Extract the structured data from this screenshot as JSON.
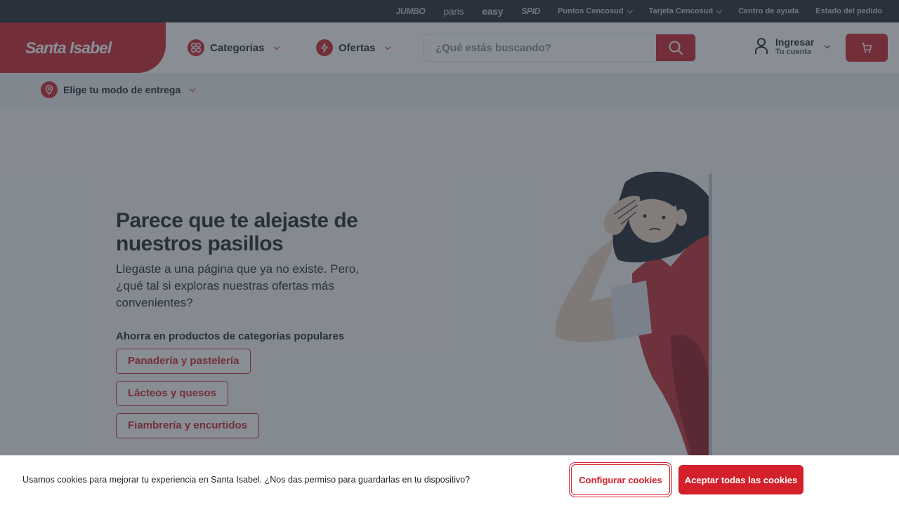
{
  "topbar": {
    "brands": [
      "JUMBO",
      "paris",
      "easy",
      "SPID"
    ],
    "links": [
      {
        "label": "Puntos Cencosud",
        "dropdown": true
      },
      {
        "label": "Tarjeta Cencosud",
        "dropdown": true
      },
      {
        "label": "Centro de ayuda",
        "dropdown": false
      },
      {
        "label": "Estado del pedido",
        "dropdown": false
      }
    ]
  },
  "header": {
    "logo": "Santa Isabel",
    "categories_label": "Categorías",
    "offers_label": "Ofertas",
    "search_placeholder": "¿Qué estás buscando?",
    "account_title": "Ingresar",
    "account_subtitle": "Tu cuenta"
  },
  "delivery": {
    "label": "Elige tu modo de entrega"
  },
  "main": {
    "title": "Parece que te alejaste de nuestros pasillos",
    "description": "Llegaste a una página que ya no existe. Pero, ¿qué tal si exploras nuestras ofertas más convenientes?",
    "categories_title": "Ahorra en productos de categorías populares",
    "categories": [
      "Panadería y pastelería",
      "Lácteos y quesos",
      "Fiambrería y encurtidos"
    ]
  },
  "cookie": {
    "message": "Usamos cookies para mejorar tu experiencia en Santa Isabel. ¿Nos das permiso para guardarlas en tu dispositivo?",
    "configure_label": "Configurar cookies",
    "accept_label": "Aceptar todas las cookies"
  },
  "colors": {
    "brand_red": "#cd2d35",
    "topbar": "#2b3239",
    "overlay": "rgba(40,50,62,0.55)",
    "cookie_red": "#d3202a"
  }
}
